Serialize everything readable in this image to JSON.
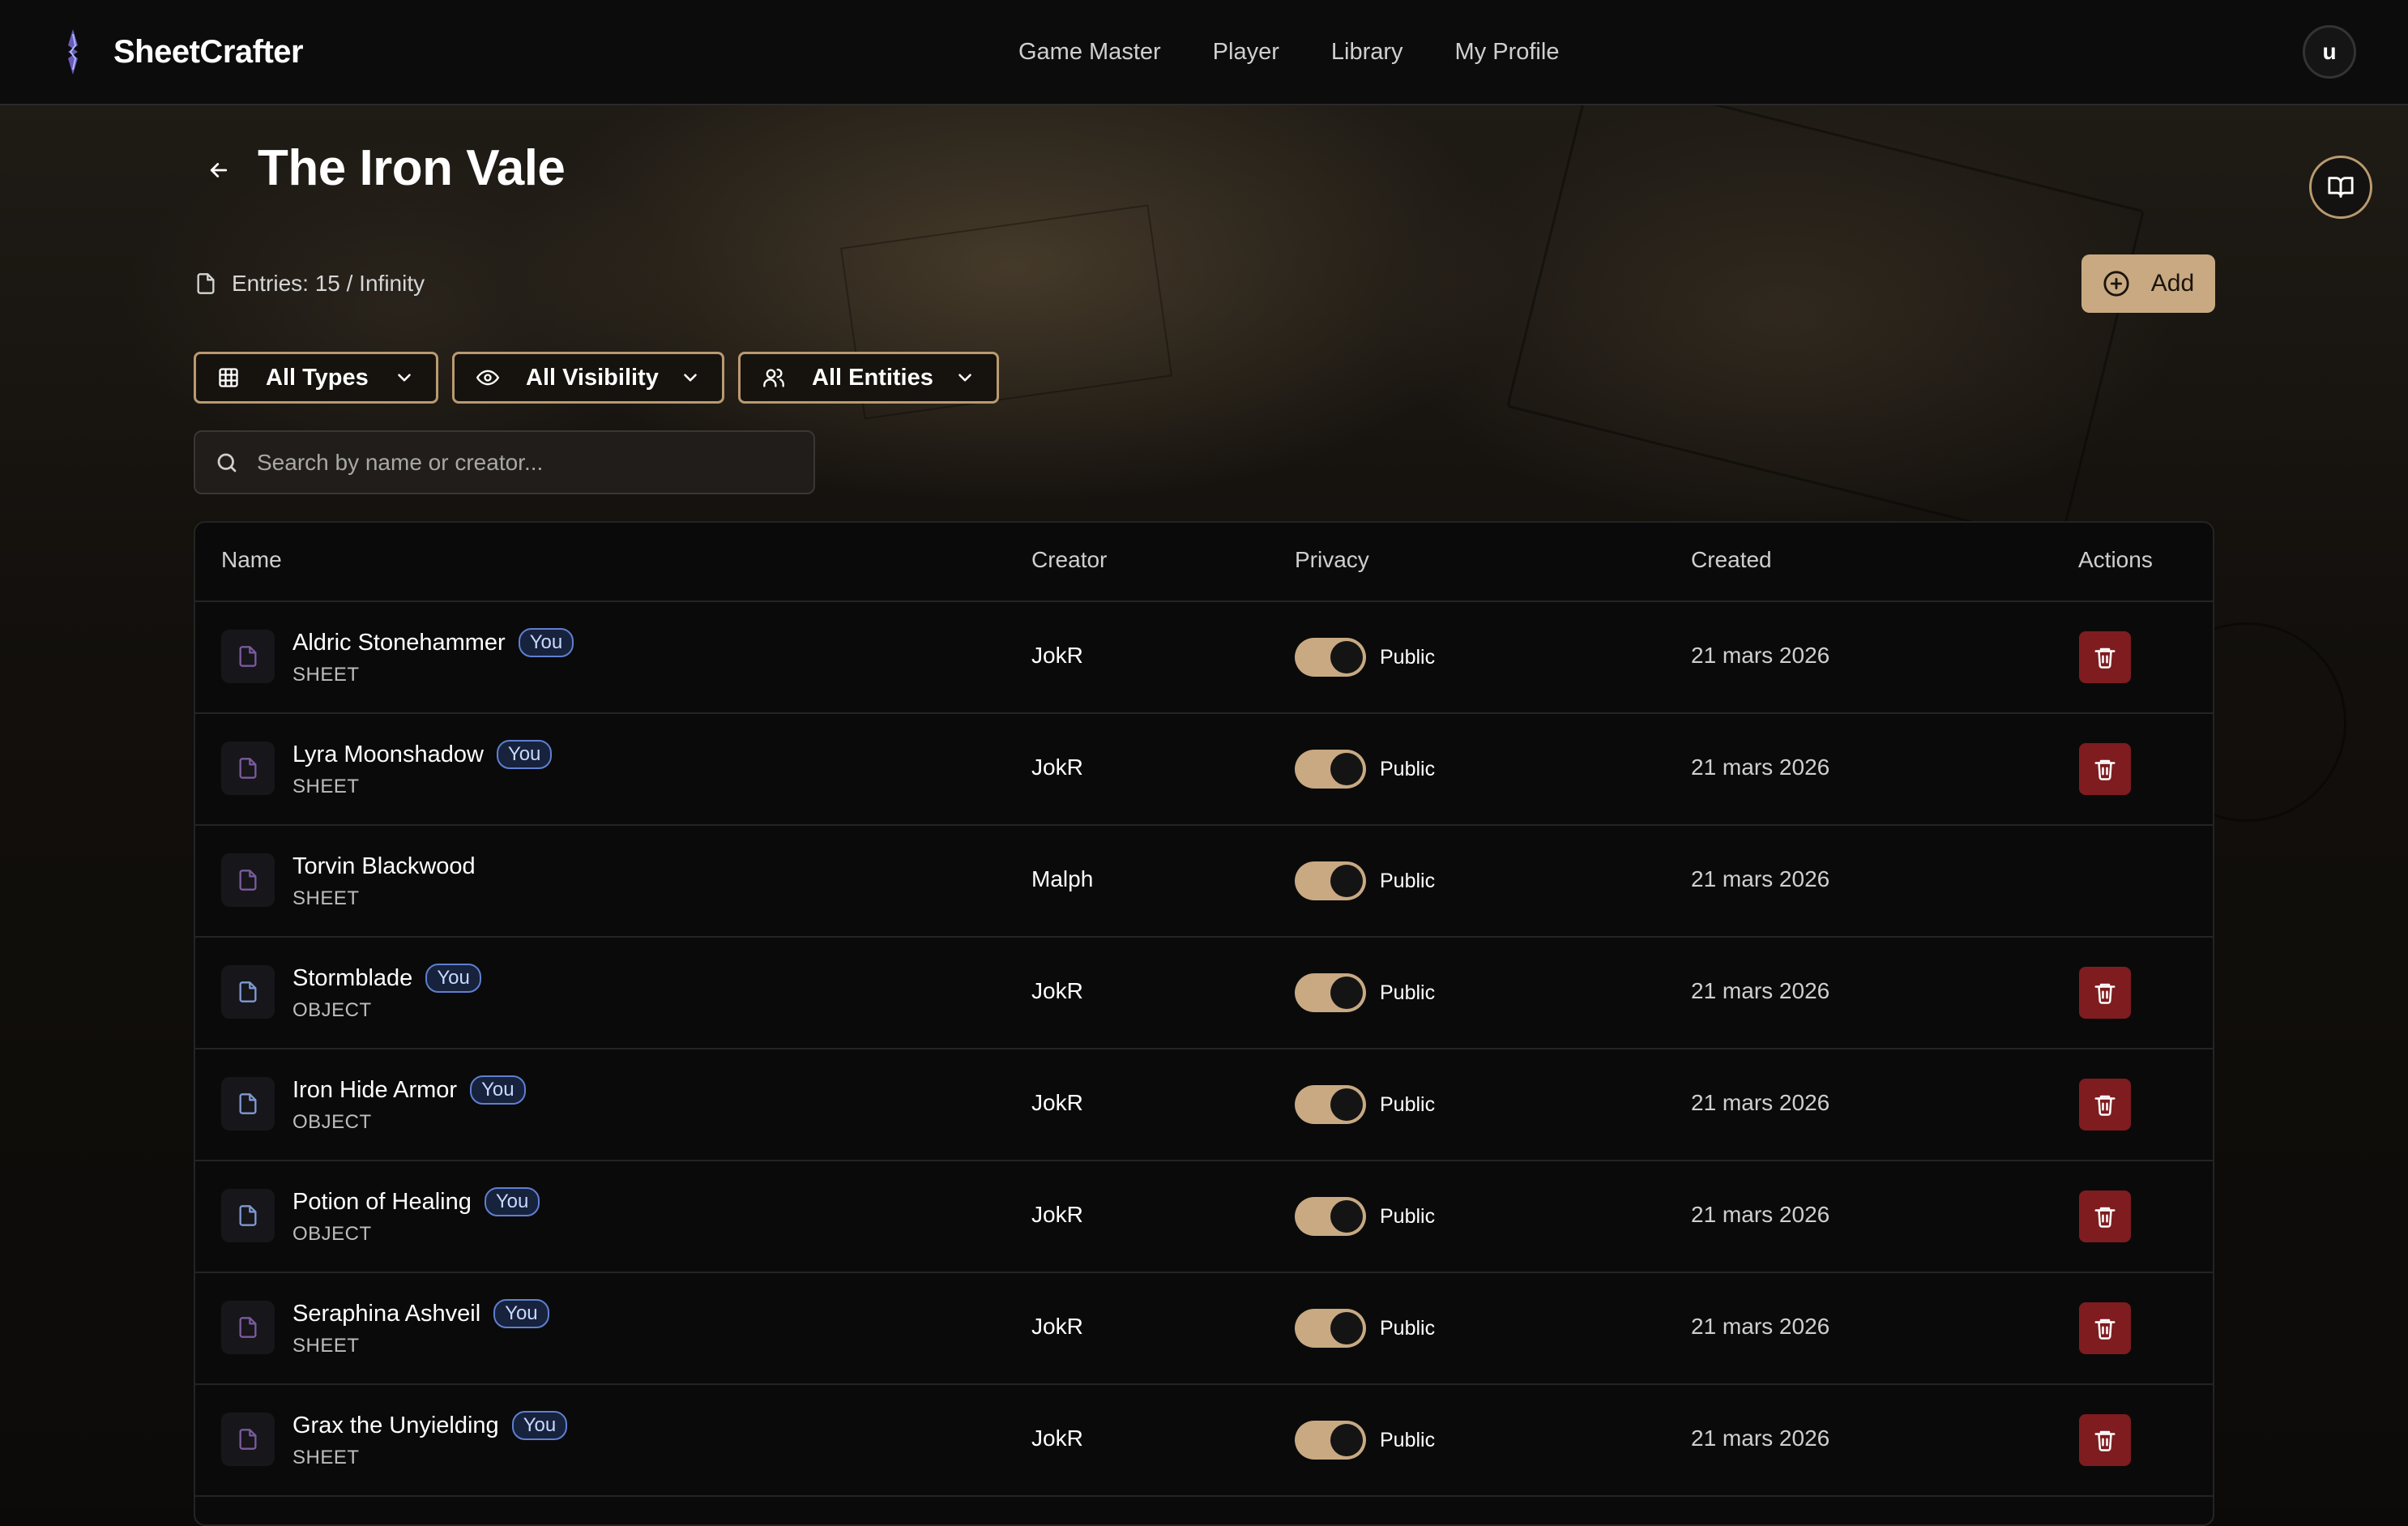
{
  "app": {
    "name": "SheetCrafter"
  },
  "nav": [
    {
      "label": "Game Master"
    },
    {
      "label": "Player"
    },
    {
      "label": "Library"
    },
    {
      "label": "My Profile"
    }
  ],
  "user": {
    "initial": "u"
  },
  "page": {
    "title": "The Iron Vale",
    "entries_text": "Entries: 15 / Infinity",
    "add_label": "Add"
  },
  "filters": {
    "types": "All Types",
    "visibility": "All Visibility",
    "entities": "All Entities"
  },
  "search": {
    "placeholder": "Search by name or creator..."
  },
  "table": {
    "headers": {
      "name": "Name",
      "creator": "Creator",
      "privacy": "Privacy",
      "created": "Created",
      "actions": "Actions"
    },
    "rows": [
      {
        "name": "Aldric Stonehammer",
        "badge": "You",
        "type": "SHEET",
        "creator": "JokR",
        "privacy": "Public",
        "created": "21 mars 2026",
        "deletable": true
      },
      {
        "name": "Lyra Moonshadow",
        "badge": "You",
        "type": "SHEET",
        "creator": "JokR",
        "privacy": "Public",
        "created": "21 mars 2026",
        "deletable": true
      },
      {
        "name": "Torvin Blackwood",
        "badge": "",
        "type": "SHEET",
        "creator": "Malph",
        "privacy": "Public",
        "created": "21 mars 2026",
        "deletable": false
      },
      {
        "name": "Stormblade",
        "badge": "You",
        "type": "OBJECT",
        "creator": "JokR",
        "privacy": "Public",
        "created": "21 mars 2026",
        "deletable": true
      },
      {
        "name": "Iron Hide Armor",
        "badge": "You",
        "type": "OBJECT",
        "creator": "JokR",
        "privacy": "Public",
        "created": "21 mars 2026",
        "deletable": true
      },
      {
        "name": "Potion of Healing",
        "badge": "You",
        "type": "OBJECT",
        "creator": "JokR",
        "privacy": "Public",
        "created": "21 mars 2026",
        "deletable": true
      },
      {
        "name": "Seraphina Ashveil",
        "badge": "You",
        "type": "SHEET",
        "creator": "JokR",
        "privacy": "Public",
        "created": "21 mars 2026",
        "deletable": true
      },
      {
        "name": "Grax the Unyielding",
        "badge": "You",
        "type": "SHEET",
        "creator": "JokR",
        "privacy": "Public",
        "created": "21 mars 2026",
        "deletable": true
      }
    ]
  },
  "colors": {
    "accent": "#c8a982",
    "danger": "#7e1c1f",
    "sheet_icon": "#7a5a9c",
    "object_icon": "#7f9ad1",
    "badge_border": "#5f7fd0"
  }
}
